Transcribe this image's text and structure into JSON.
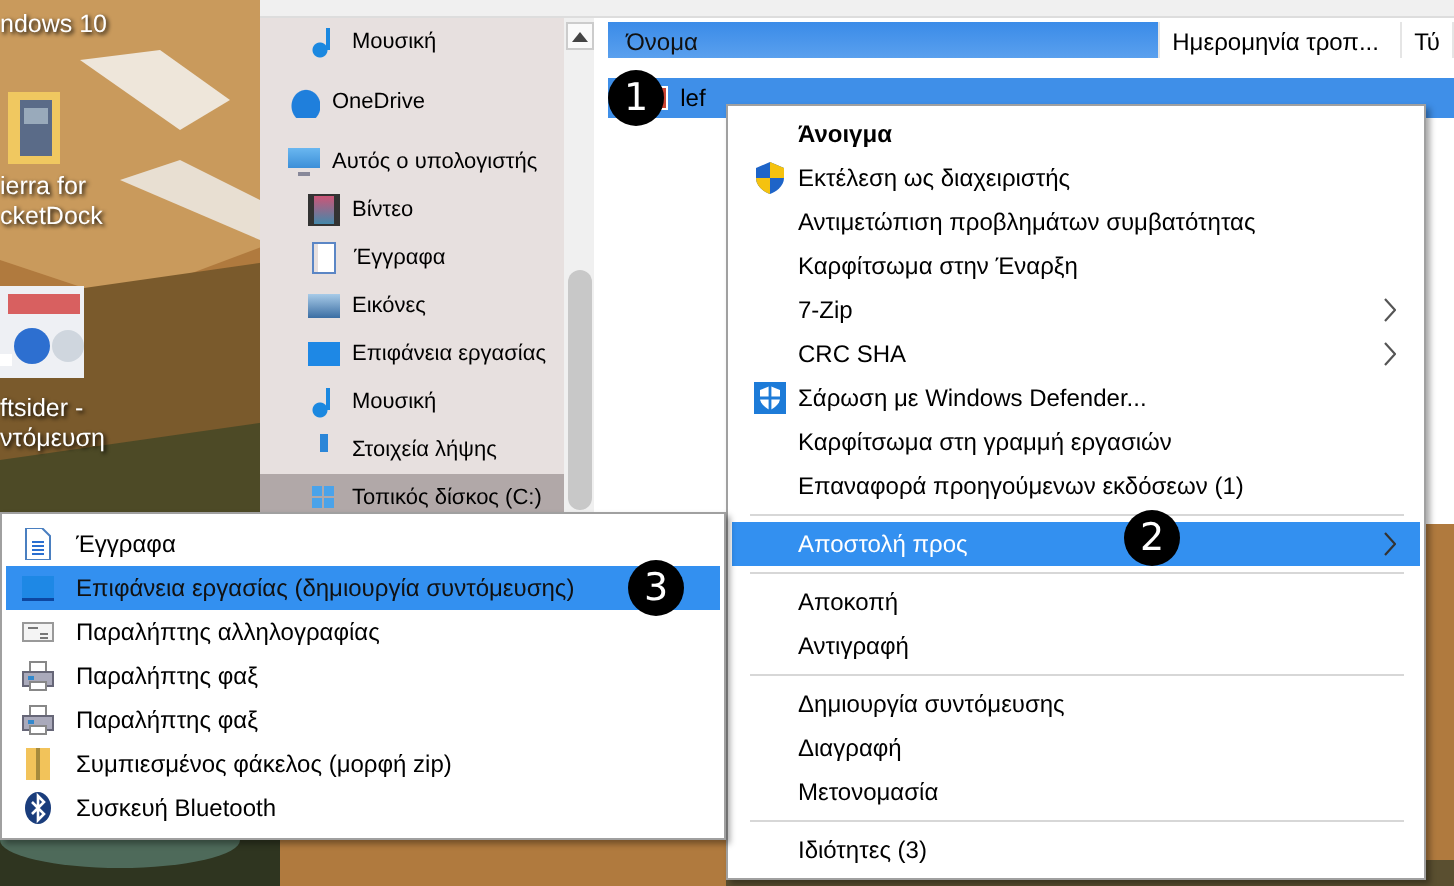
{
  "desktop_items": [
    {
      "kind": "label_only",
      "label": "ndows 10"
    },
    {
      "kind": "folder",
      "label": "ierra for\ncketDock"
    },
    {
      "kind": "shortcut",
      "label": "ftsider -\nντόμευση"
    }
  ],
  "explorer": {
    "navigation_pane": {
      "top_items": [
        {
          "kind": "music",
          "label": "Μουσική",
          "selected": false
        }
      ],
      "items": [
        {
          "kind": "cloud",
          "label": "OneDrive",
          "selected": false
        },
        {
          "kind": "computer",
          "label": "Αυτός ο υπολογιστής",
          "selected": false,
          "children": [
            {
              "kind": "video",
              "label": "Βίντεο",
              "selected": false
            },
            {
              "kind": "documents",
              "label": "Έγγραφα",
              "selected": false
            },
            {
              "kind": "pictures",
              "label": "Εικόνες",
              "selected": false
            },
            {
              "kind": "desktop",
              "label": "Επιφάνεια εργασίας",
              "selected": false
            },
            {
              "kind": "music",
              "label": "Μουσική",
              "selected": false
            },
            {
              "kind": "download",
              "label": "Στοιχεία λήψης",
              "selected": false
            },
            {
              "kind": "drive",
              "label": "Τοπικός δίσκος (C:)",
              "selected": true
            }
          ]
        }
      ]
    },
    "column_headers": [
      {
        "label": "Όνομα",
        "selected": true
      },
      {
        "label": "Ημερομηνία τροπ...",
        "selected": false
      },
      {
        "label": "Τύ",
        "selected": false
      }
    ],
    "rows": [
      {
        "name": "lef",
        "selected": true
      }
    ]
  },
  "context_menu": {
    "groups": [
      [
        {
          "kind": "plain",
          "label": "Άνοιγμα",
          "default": true,
          "selected": false
        },
        {
          "kind": "shield",
          "label": "Εκτέλεση ως διαχειριστής",
          "selected": false
        },
        {
          "kind": "plain",
          "label": "Αντιμετώπιση προβλημάτων συμβατότητας",
          "selected": false
        },
        {
          "kind": "plain",
          "label": "Καρφίτσωμα στην Έναρξη",
          "selected": false
        },
        {
          "kind": "submenu",
          "label": "7-Zip",
          "selected": false
        },
        {
          "kind": "submenu",
          "label": "CRC SHA",
          "selected": false
        },
        {
          "kind": "defender",
          "label": "Σάρωση με Windows Defender...",
          "selected": false
        },
        {
          "kind": "plain",
          "label": "Καρφίτσωμα στη γραμμή εργασιών",
          "selected": false
        },
        {
          "kind": "plain",
          "label": "Επαναφορά προηγούμενων εκδόσεων (1)",
          "selected": false
        }
      ],
      [
        {
          "kind": "submenu",
          "label": "Αποστολή προς",
          "selected": true
        }
      ],
      [
        {
          "kind": "plain",
          "label": "Αποκοπή",
          "selected": false
        },
        {
          "kind": "plain",
          "label": "Αντιγραφή",
          "selected": false
        }
      ],
      [
        {
          "kind": "plain",
          "label": "Δημιουργία συντόμευσης",
          "selected": false
        },
        {
          "kind": "plain",
          "label": "Διαγραφή",
          "selected": false
        },
        {
          "kind": "plain",
          "label": "Μετονομασία",
          "selected": false
        }
      ],
      [
        {
          "kind": "plain",
          "label": "Ιδιότητες (3)",
          "selected": false
        }
      ]
    ]
  },
  "send_to_menu": {
    "items": [
      {
        "kind": "documents",
        "label": "Έγγραφα",
        "selected": false
      },
      {
        "kind": "desktop",
        "label": "Επιφάνεια εργασίας (δημιουργία συντόμευσης)",
        "selected": true
      },
      {
        "kind": "mail",
        "label": "Παραλήπτης αλληλογραφίας",
        "selected": false
      },
      {
        "kind": "fax",
        "label": "Παραλήπτης φαξ",
        "selected": false
      },
      {
        "kind": "fax",
        "label": "Παραλήπτης φαξ",
        "selected": false
      },
      {
        "kind": "zip",
        "label": "Συμπιεσμένος φάκελος (μορφή zip)",
        "selected": false
      },
      {
        "kind": "bluetooth",
        "label": "Συσκευή Bluetooth",
        "selected": false
      }
    ]
  },
  "step_badges": [
    "1",
    "2",
    "3"
  ]
}
